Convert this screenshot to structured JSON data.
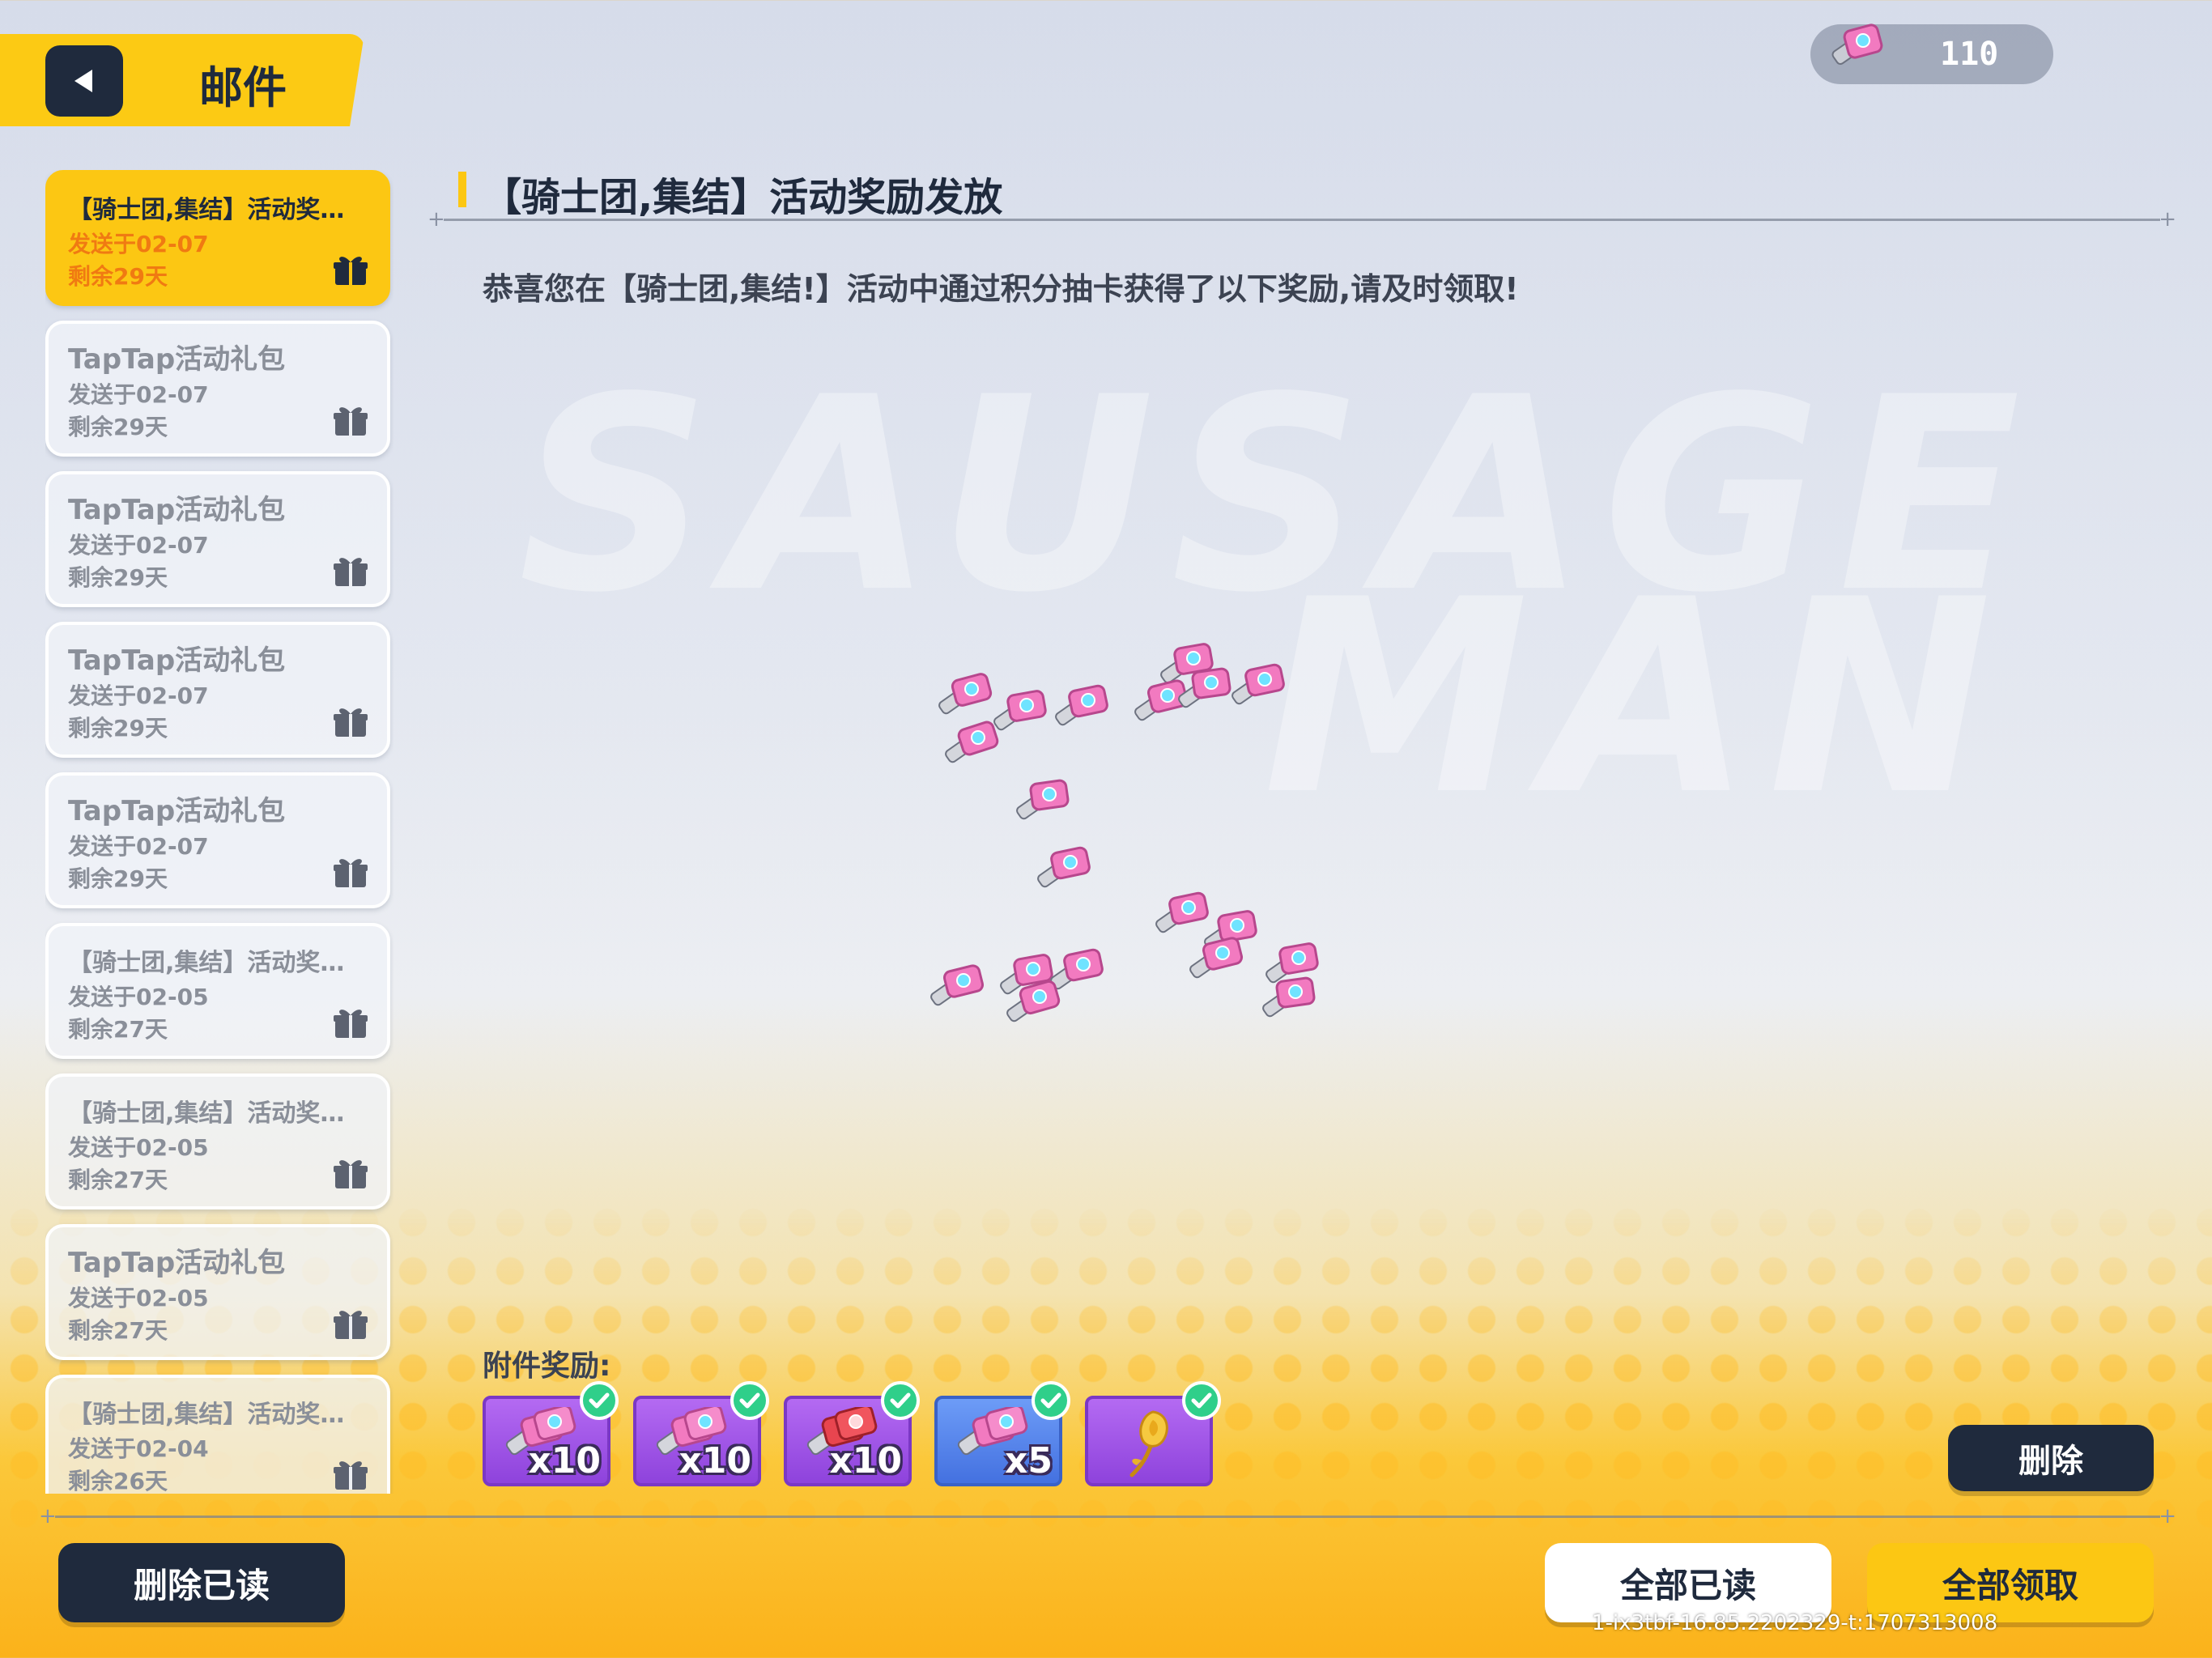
{
  "header": {
    "title": "邮件",
    "back_icon": "back-arrow-icon"
  },
  "currency": {
    "icon": "coupon-icon",
    "value": "110"
  },
  "mail_list": [
    {
      "title": "【骑士团,集结】活动奖励发放",
      "sent": "发送于02-07",
      "remaining": "剩余29天",
      "selected": true
    },
    {
      "title": "TapTap活动礼包",
      "sent": "发送于02-07",
      "remaining": "剩余29天",
      "selected": false
    },
    {
      "title": "TapTap活动礼包",
      "sent": "发送于02-07",
      "remaining": "剩余29天",
      "selected": false
    },
    {
      "title": "TapTap活动礼包",
      "sent": "发送于02-07",
      "remaining": "剩余29天",
      "selected": false
    },
    {
      "title": "TapTap活动礼包",
      "sent": "发送于02-07",
      "remaining": "剩余29天",
      "selected": false
    },
    {
      "title": "【骑士团,集结】活动奖励发放",
      "sent": "发送于02-05",
      "remaining": "剩余27天",
      "selected": false
    },
    {
      "title": "【骑士团,集结】活动奖励发放",
      "sent": "发送于02-05",
      "remaining": "剩余27天",
      "selected": false
    },
    {
      "title": "TapTap活动礼包",
      "sent": "发送于02-05",
      "remaining": "剩余27天",
      "selected": false
    },
    {
      "title": "【骑士团,集结】活动奖励发放",
      "sent": "发送于02-04",
      "remaining": "剩余26天",
      "selected": false
    }
  ],
  "content": {
    "title": "【骑士团,集结】活动奖励发放",
    "body": "恭喜您在【骑士团,集结!】活动中通过积分抽卡获得了以下奖励,请及时领取!",
    "attachments_label": "附件奖励:",
    "attachments": [
      {
        "quantity": "x10",
        "icon": "pink-coupon-icon",
        "claimed": true
      },
      {
        "quantity": "x10",
        "icon": "pink-coupon-icon",
        "claimed": true
      },
      {
        "quantity": "x10",
        "icon": "red-coupon-icon",
        "claimed": true
      },
      {
        "quantity": "x5",
        "icon": "pink-coupon-icon",
        "claimed": true
      },
      {
        "quantity": "",
        "icon": "golden-rose-icon",
        "claimed": true
      }
    ]
  },
  "buttons": {
    "delete": "删除",
    "delete_read": "删除已读",
    "read_all": "全部已读",
    "claim_all": "全部领取"
  },
  "build_id": "1-ix3tbf-16.85.2202329-t:1707313008",
  "colors": {
    "accent": "#fcc713",
    "dark": "#1f2a3d",
    "claimed": "#2fcf8a"
  }
}
